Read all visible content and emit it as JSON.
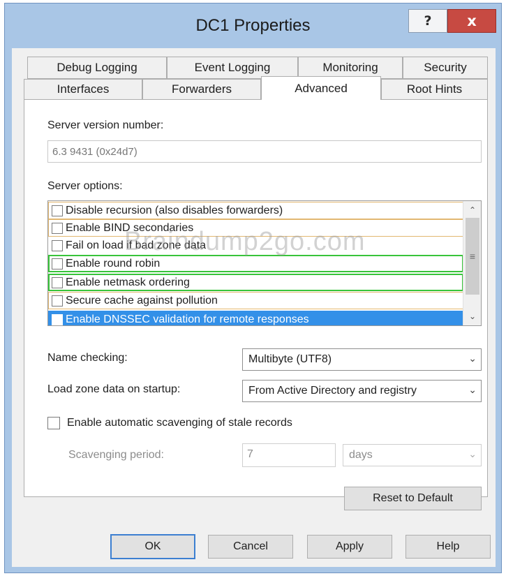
{
  "window": {
    "title": "DC1 Properties"
  },
  "titlebar": {
    "help_label": "?",
    "close_label": "x"
  },
  "tabs": {
    "row1": [
      "Debug Logging",
      "Event Logging",
      "Monitoring",
      "Security"
    ],
    "row2": [
      "Interfaces",
      "Forwarders",
      "Advanced",
      "Root Hints"
    ],
    "active": "Advanced"
  },
  "advanced": {
    "version_label": "Server version number:",
    "version_value": "6.3 9431 (0x24d7)",
    "options_label": "Server options:",
    "options": [
      "Disable recursion (also disables forwarders)",
      "Enable BIND secondaries",
      "Fail on load if bad zone data",
      "Enable round robin",
      "Enable netmask ordering",
      "Secure cache against pollution",
      "Enable DNSSEC validation for remote responses"
    ],
    "name_checking_label": "Name checking:",
    "name_checking_value": "Multibyte (UTF8)",
    "load_zone_label": "Load zone data on startup:",
    "load_zone_value": "From Active Directory and registry",
    "scavenging_checkbox_label": "Enable automatic scavenging of stale records",
    "scavenging_period_label": "Scavenging period:",
    "scavenging_period_value": "7",
    "scavenging_unit": "days",
    "reset_label": "Reset to Default"
  },
  "footer": {
    "ok": "OK",
    "cancel": "Cancel",
    "apply": "Apply",
    "help": "Help"
  },
  "watermark": "Braindump2go.com",
  "colors": {
    "selection": "#3390e8",
    "highlight_green": "#38c43a",
    "highlight_amber": "#e2b770",
    "close_red": "#c74a42"
  }
}
